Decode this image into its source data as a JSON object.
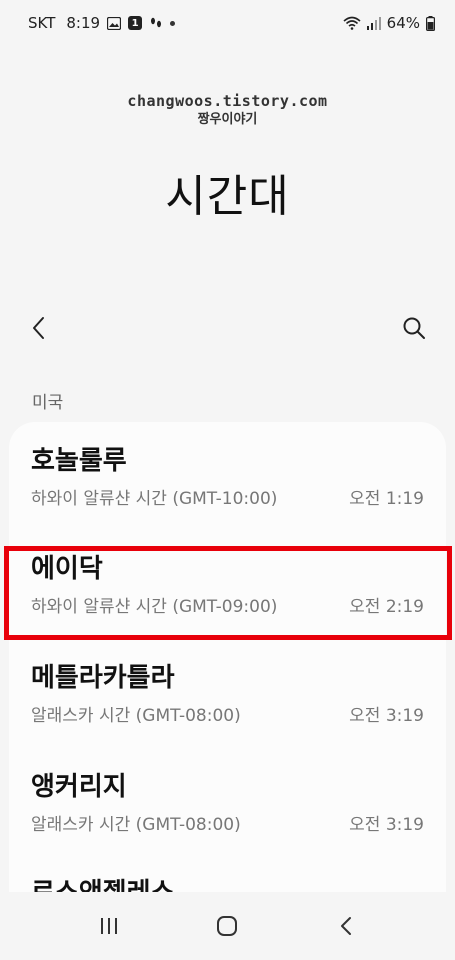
{
  "status_bar": {
    "carrier": "SKT",
    "time": "8:19",
    "notification_count": "1",
    "battery": "64%"
  },
  "watermark": {
    "site": "changwoos.tistory.com",
    "name": "짱우이야기"
  },
  "header": {
    "title": "시간대"
  },
  "section": {
    "label": "미국"
  },
  "timezones": [
    {
      "name": "호놀룰루",
      "zone": "하와이 알류샨 시간 (GMT-10:00)",
      "time": "오전 1:19"
    },
    {
      "name": "에이닥",
      "zone": "하와이 알류샨 시간 (GMT-09:00)",
      "time": "오전 2:19"
    },
    {
      "name": "메틀라카틀라",
      "zone": "알래스카 시간 (GMT-08:00)",
      "time": "오전 3:19"
    },
    {
      "name": "앵커리지",
      "zone": "알래스카 시간 (GMT-08:00)",
      "time": "오전 3:19"
    },
    {
      "name": "로스앤젤레스"
    }
  ],
  "colors": {
    "highlight": "#e8000a",
    "background": "#f5f5f5",
    "card": "#fcfcfc"
  },
  "icons": {
    "back": "back-arrow-icon",
    "search": "search-icon",
    "recents": "recents-icon",
    "home": "home-icon",
    "nav_back": "nav-back-icon"
  }
}
